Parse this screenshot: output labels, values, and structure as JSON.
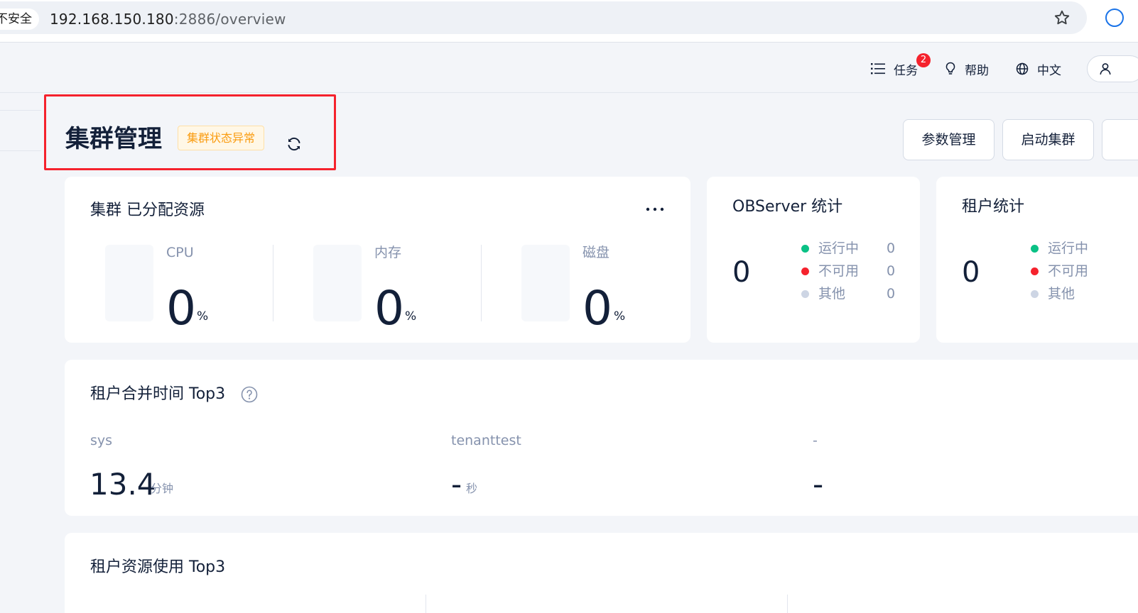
{
  "browser": {
    "security_label": "不安全",
    "url_host": "192.168.150.180",
    "url_rest": ":2886/overview"
  },
  "header": {
    "tasks_label": "任务",
    "tasks_badge": "2",
    "help_label": "帮助",
    "language_label": "中文"
  },
  "page": {
    "title": "集群管理",
    "status_tag": "集群状态异常",
    "buttons": {
      "params": "参数管理",
      "start": "启动集群"
    }
  },
  "resources_card": {
    "title": "集群 已分配资源",
    "items": [
      {
        "label": "CPU",
        "value": "0",
        "unit": "%"
      },
      {
        "label": "内存",
        "value": "0",
        "unit": "%"
      },
      {
        "label": "磁盘",
        "value": "0",
        "unit": "%"
      }
    ]
  },
  "observer_card": {
    "title": "OBServer 统计",
    "total": "0",
    "legend": [
      {
        "label": "运行中",
        "count": "0",
        "color": "#0ac185"
      },
      {
        "label": "不可用",
        "count": "0",
        "color": "#f5222d"
      },
      {
        "label": "其他",
        "count": "0",
        "color": "#cdd5e4"
      }
    ]
  },
  "tenant_card": {
    "title": "租户统计",
    "total": "0",
    "legend": [
      {
        "label": "运行中",
        "color": "#0ac185"
      },
      {
        "label": "不可用",
        "color": "#f5222d"
      },
      {
        "label": "其他",
        "color": "#cdd5e4"
      }
    ]
  },
  "merge_card": {
    "title": "租户合并时间 Top3",
    "items": [
      {
        "name": "sys",
        "value": "13.4",
        "unit": "分钟"
      },
      {
        "name": "tenanttest",
        "value": "-",
        "unit": "秒"
      },
      {
        "name": "-",
        "value": "-",
        "unit": ""
      }
    ]
  },
  "usage_card": {
    "title": "租户资源使用 Top3"
  }
}
